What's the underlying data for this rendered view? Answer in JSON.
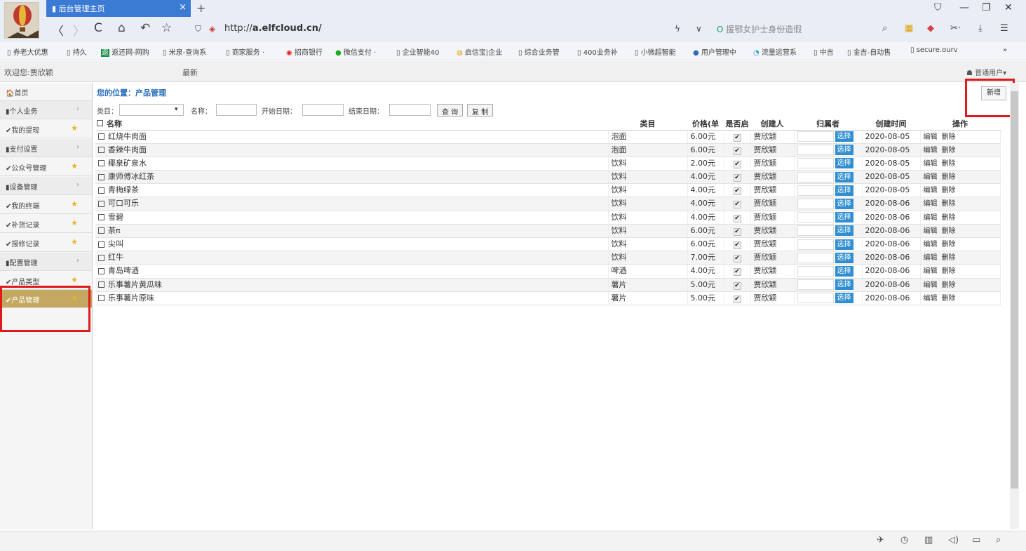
{
  "browser": {
    "tab_title": "后台管理主页",
    "tab_close": "×",
    "new_tab": "+",
    "url_prefix": "http://",
    "url_host": "a.elfcloud.cn/",
    "search_hint": "援鄂女护士身份造假",
    "window_controls": [
      "⛉",
      "—",
      "❐",
      "✕"
    ],
    "nav_icons": [
      "〈",
      "〉",
      "C",
      "⌂",
      "↶",
      "☆"
    ]
  },
  "bookmarks": [
    "券老大优惠",
    "持久",
    "返还网-网购",
    "米泉-查询系",
    "商家服务 ·",
    "招商银行",
    "微信支付 ·",
    "企业智能40",
    "启信宝|企业",
    "综合业务管",
    "400业务补",
    "小微超智能",
    "用户管理中",
    "流量运营系",
    "中吉",
    "金吉-自动售",
    "secure.ourv",
    "»"
  ],
  "header": {
    "welcome": "欢迎您:贾欣颖",
    "latest": "最新",
    "user_menu": "普通用户▾"
  },
  "sidebar": {
    "items": [
      {
        "label": "首页",
        "prefix": "🏠",
        "type": "link"
      },
      {
        "label": "个人业务",
        "prefix": "▮",
        "type": "group"
      },
      {
        "label": "我的提现",
        "prefix": "✔",
        "type": "leaf"
      },
      {
        "label": "支付设置",
        "prefix": "▮",
        "type": "group"
      },
      {
        "label": "公众号管理",
        "prefix": "✔",
        "type": "leaf"
      },
      {
        "label": "设备管理",
        "prefix": "▮",
        "type": "group"
      },
      {
        "label": "我的终端",
        "prefix": "✔",
        "type": "leaf"
      },
      {
        "label": "补货记录",
        "prefix": "✔",
        "type": "leaf"
      },
      {
        "label": "报修记录",
        "prefix": "✔",
        "type": "leaf"
      },
      {
        "label": "配置管理",
        "prefix": "▮",
        "type": "group"
      },
      {
        "label": "产品类型",
        "prefix": "✔",
        "type": "leaf"
      },
      {
        "label": "产品管理",
        "prefix": "✔",
        "type": "active"
      }
    ]
  },
  "main": {
    "breadcrumb": "您的位置：产品管理",
    "add_button": "新增",
    "filters": {
      "category_label": "类目：",
      "name_label": "名称：",
      "start_label": "开始日期：",
      "end_label": "结束日期：",
      "query_button": "查 询",
      "copy_button": "复 制"
    },
    "table": {
      "headers": [
        "名称",
        "类目",
        "价格(单",
        "是否启",
        "创建人",
        "归属者",
        "创建时间",
        "操作"
      ],
      "pick_label": "选择",
      "edit_label": "编辑",
      "delete_label": "删除",
      "rows": [
        {
          "name": "红烧牛肉面",
          "category": "泡面",
          "price": "6.00元",
          "creator": "贾欣颖",
          "created": "2020-08-05"
        },
        {
          "name": "香辣牛肉面",
          "category": "泡面",
          "price": "6.00元",
          "creator": "贾欣颖",
          "created": "2020-08-05"
        },
        {
          "name": "椰泉矿泉水",
          "category": "饮料",
          "price": "2.00元",
          "creator": "贾欣颖",
          "created": "2020-08-05"
        },
        {
          "name": "康师傅冰红茶",
          "category": "饮料",
          "price": "4.00元",
          "creator": "贾欣颖",
          "created": "2020-08-05"
        },
        {
          "name": "青梅绿茶",
          "category": "饮料",
          "price": "4.00元",
          "creator": "贾欣颖",
          "created": "2020-08-05"
        },
        {
          "name": "可口可乐",
          "category": "饮料",
          "price": "4.00元",
          "creator": "贾欣颖",
          "created": "2020-08-06"
        },
        {
          "name": "雪碧",
          "category": "饮料",
          "price": "4.00元",
          "creator": "贾欣颖",
          "created": "2020-08-06"
        },
        {
          "name": "茶π",
          "category": "饮料",
          "price": "6.00元",
          "creator": "贾欣颖",
          "created": "2020-08-06"
        },
        {
          "name": "尖叫",
          "category": "饮料",
          "price": "6.00元",
          "creator": "贾欣颖",
          "created": "2020-08-06"
        },
        {
          "name": "红牛",
          "category": "饮料",
          "price": "7.00元",
          "creator": "贾欣颖",
          "created": "2020-08-06"
        },
        {
          "name": "青岛啤酒",
          "category": "啤酒",
          "price": "4.00元",
          "creator": "贾欣颖",
          "created": "2020-08-06"
        },
        {
          "name": "乐事薯片黄瓜味",
          "category": "薯片",
          "price": "5.00元",
          "creator": "贾欣颖",
          "created": "2020-08-06"
        },
        {
          "name": "乐事薯片原味",
          "category": "薯片",
          "price": "5.00元",
          "creator": "贾欣颖",
          "created": "2020-08-06"
        }
      ]
    }
  },
  "colors": {
    "tab_active": "#3b7bd4",
    "sidebar_active": "#c4a761",
    "highlight_box": "#e01a1a",
    "pick_button": "#2f8fd0"
  }
}
